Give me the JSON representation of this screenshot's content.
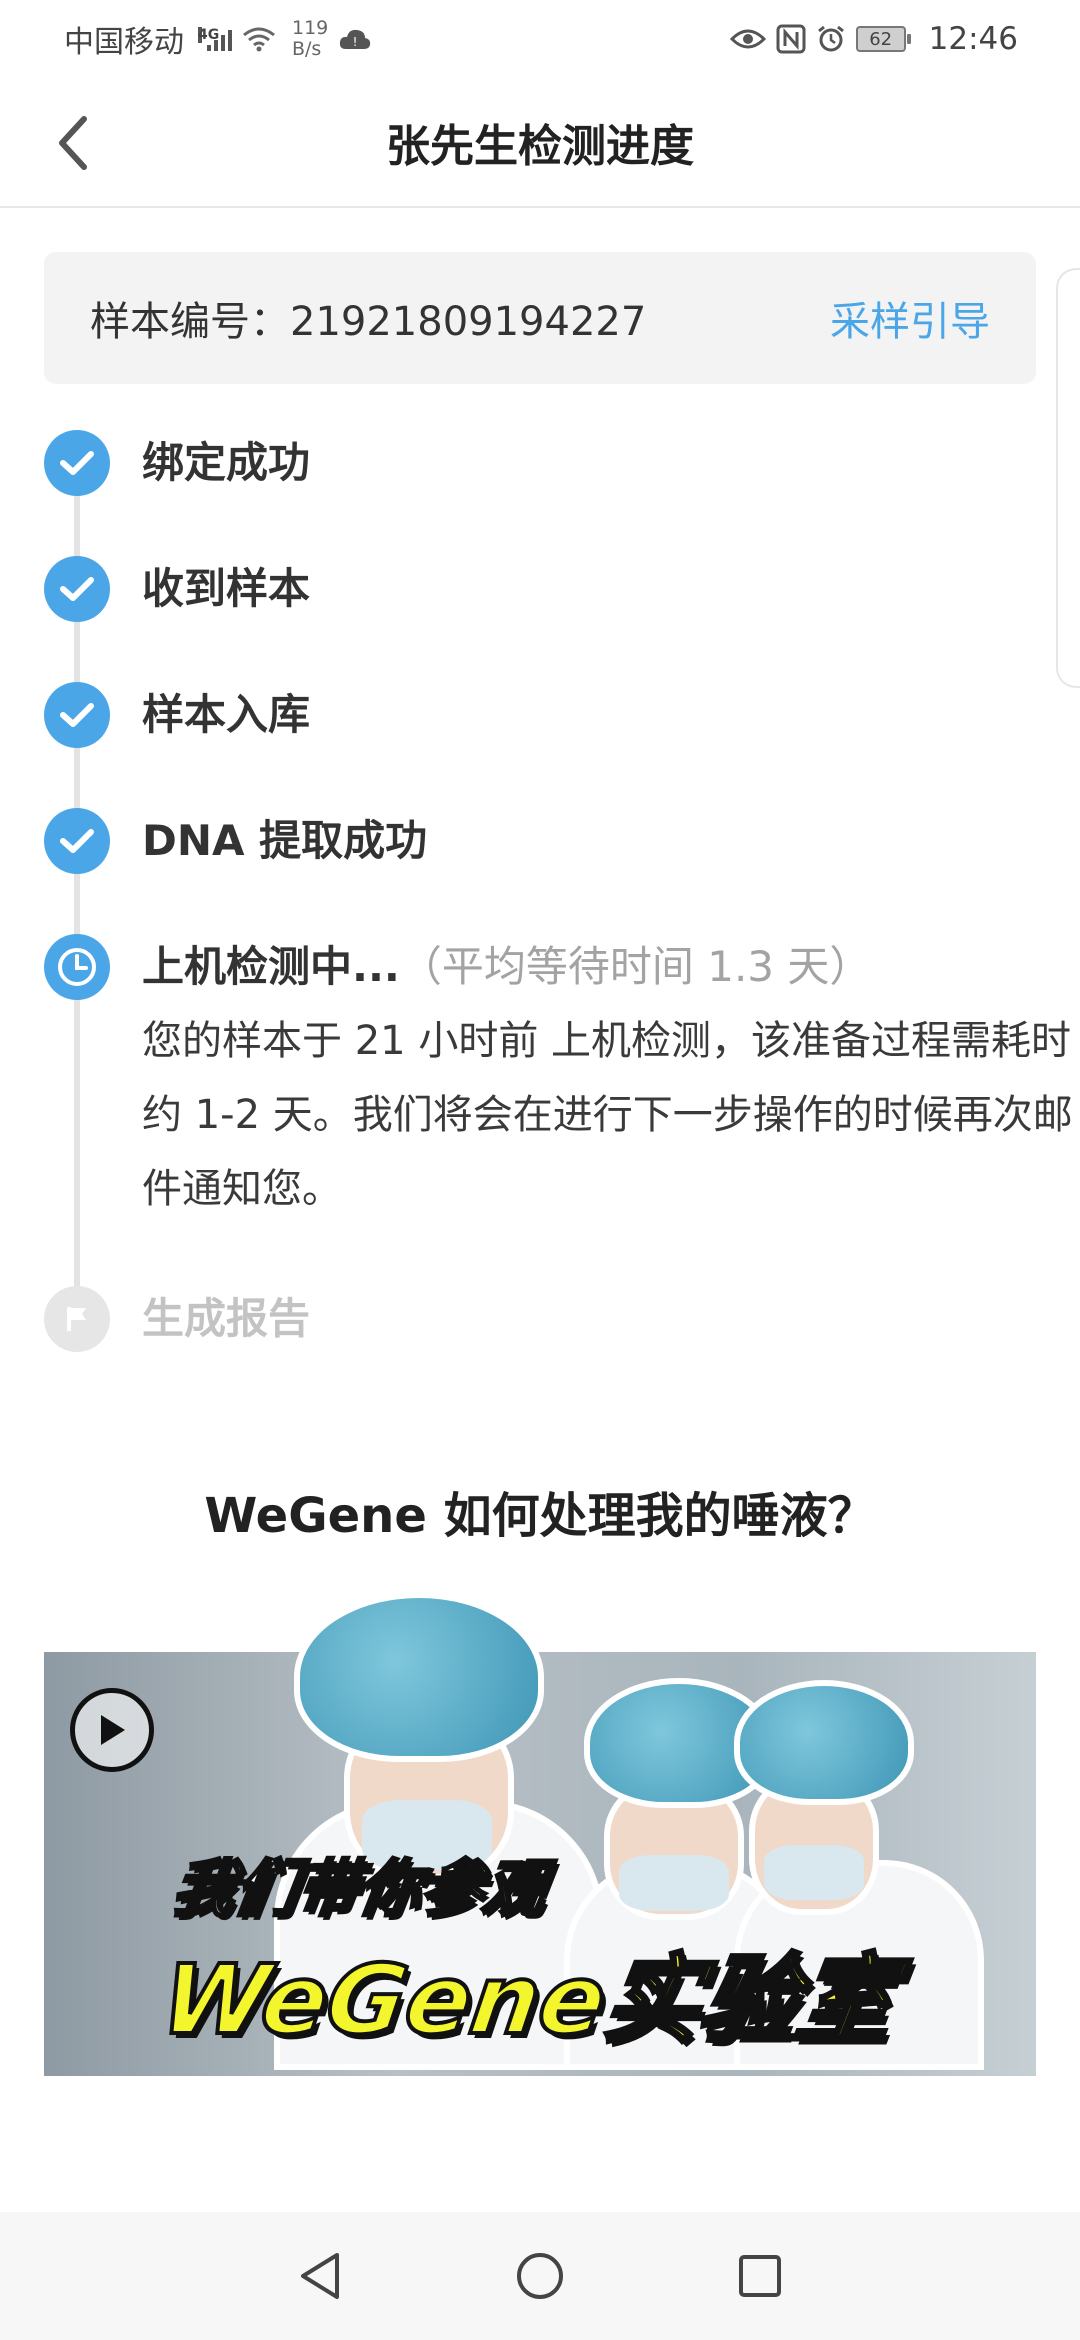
{
  "status_bar": {
    "carrier": "中国移动",
    "network_tag": "4G",
    "speed_value": "119",
    "speed_unit": "B/s",
    "battery": "62",
    "time": "12:46"
  },
  "header": {
    "title": "张先生检测进度"
  },
  "sample": {
    "label": "样本编号：21921809194227",
    "guide_link": "采样引导"
  },
  "timeline": {
    "steps": [
      {
        "label": "绑定成功",
        "status": "done"
      },
      {
        "label": "收到样本",
        "status": "done"
      },
      {
        "label": "样本入库",
        "status": "done"
      },
      {
        "label": "DNA 提取成功",
        "status": "done"
      },
      {
        "label": "上机检测中...",
        "note": "（平均等待时间 1.3 天）",
        "status": "active",
        "description": "您的样本于 21 小时前 上机检测，该准备过程需耗时约 1-2 天。我们将会在进行下一步操作的时候再次邮件通知您。"
      },
      {
        "label": "生成报告",
        "status": "pending"
      }
    ]
  },
  "section": {
    "title": "WeGene 如何处理我的唾液？"
  },
  "video": {
    "line1": "我们带你参观",
    "line2": "WeGene实验室"
  },
  "colors": {
    "accent": "#4ba6e8",
    "pending": "#e6e6e6",
    "video_title_yellow": "#f3f52d"
  },
  "icons": [
    "back-icon",
    "check-icon",
    "clock-icon",
    "flag-icon",
    "play-icon",
    "nav-back-icon",
    "nav-home-icon",
    "nav-recents-icon"
  ]
}
